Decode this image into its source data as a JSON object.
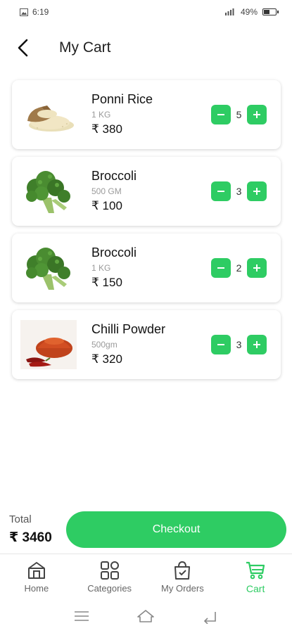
{
  "status_bar": {
    "time": "6:19",
    "battery": "49%",
    "battery_level": 0.49
  },
  "header": {
    "title": "My Cart",
    "back_icon": "chevron-left-icon"
  },
  "cart": {
    "items": [
      {
        "name": "Ponni Rice",
        "unit": "1 KG",
        "price": "₹ 380",
        "quantity": "5",
        "image": "rice-image"
      },
      {
        "name": "Broccoli",
        "unit": "500 GM",
        "price": "₹ 100",
        "quantity": "3",
        "image": "broccoli-image"
      },
      {
        "name": "Broccoli",
        "unit": "1 KG",
        "price": "₹ 150",
        "quantity": "2",
        "image": "broccoli-image"
      },
      {
        "name": "Chilli Powder",
        "unit": "500gm",
        "price": "₹ 320",
        "quantity": "3",
        "image": "chilli-powder-image"
      }
    ]
  },
  "footer": {
    "total_label": "Total",
    "total_value": "₹ 3460",
    "checkout_label": "Checkout"
  },
  "bottom_nav": {
    "items": [
      {
        "label": "Home",
        "icon": "home-icon",
        "active": false
      },
      {
        "label": "Categories",
        "icon": "grid-icon",
        "active": false
      },
      {
        "label": "My Orders",
        "icon": "shopping-bag-icon",
        "active": false
      },
      {
        "label": "Cart",
        "icon": "cart-icon",
        "active": true
      }
    ]
  },
  "colors": {
    "accent": "#2ecc63",
    "text": "#111111",
    "muted": "#9a9a9a"
  }
}
